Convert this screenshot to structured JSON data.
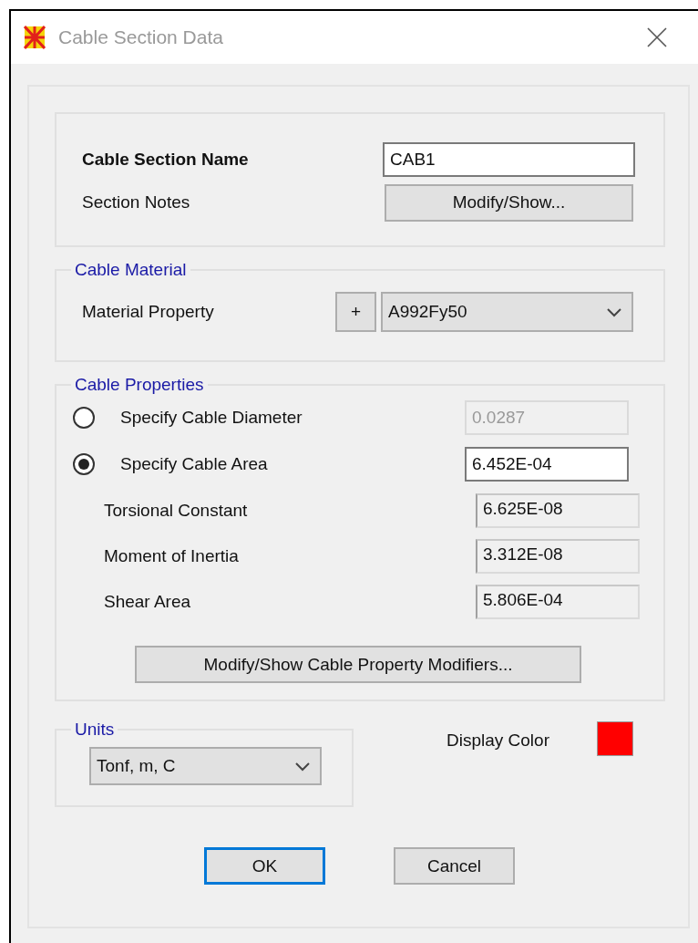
{
  "window": {
    "title": "Cable Section Data"
  },
  "name_section": {
    "label": "Cable Section Name",
    "value": "CAB1",
    "notes_label": "Section Notes",
    "notes_button": "Modify/Show..."
  },
  "material": {
    "legend": "Cable Material",
    "label": "Material Property",
    "add_button": "+",
    "value": "A992Fy50"
  },
  "properties": {
    "legend": "Cable Properties",
    "rows": [
      {
        "kind": "radio",
        "label": "Specify Cable Diameter",
        "selected": false,
        "value": "0.0287",
        "disabled": true
      },
      {
        "kind": "radio",
        "label": "Specify Cable Area",
        "selected": true,
        "value": "6.452E-04",
        "disabled": false
      },
      {
        "kind": "readout",
        "label": "Torsional Constant",
        "value": "6.625E-08"
      },
      {
        "kind": "readout",
        "label": "Moment of Inertia",
        "value": "3.312E-08"
      },
      {
        "kind": "readout",
        "label": "Shear Area",
        "value": "5.806E-04"
      }
    ],
    "modifiers_button": "Modify/Show Cable Property Modifiers..."
  },
  "units": {
    "legend": "Units",
    "value": "Tonf, m, C"
  },
  "display_color": {
    "label": "Display Color",
    "color": "#ff0000"
  },
  "buttons": [
    {
      "label": "OK",
      "default": true
    },
    {
      "label": "Cancel",
      "default": false
    }
  ]
}
